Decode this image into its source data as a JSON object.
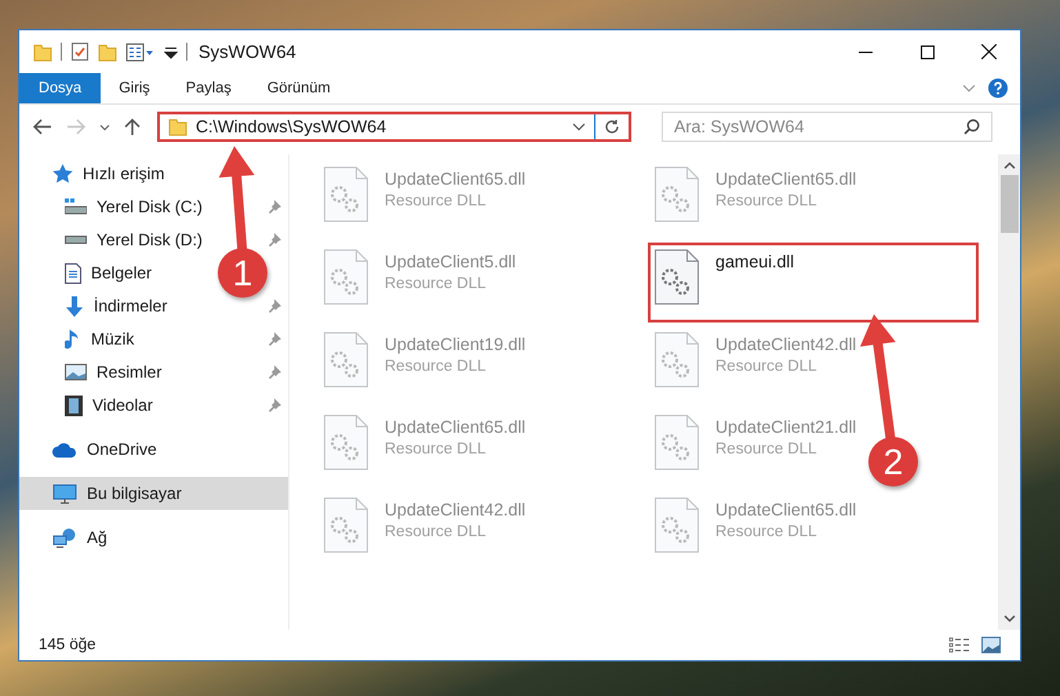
{
  "window": {
    "title": "SysWOW64"
  },
  "ribbon_tabs": [
    {
      "label": "Dosya",
      "selected": true
    },
    {
      "label": "Giriş",
      "selected": false
    },
    {
      "label": "Paylaş",
      "selected": false
    },
    {
      "label": "Görünüm",
      "selected": false
    }
  ],
  "navigation": {
    "back_disabled": false,
    "forward_disabled": true
  },
  "address_bar": {
    "value": "C:\\Windows\\SysWOW64",
    "highlighted": true
  },
  "search": {
    "placeholder": "Ara: SysWOW64"
  },
  "sidebar": {
    "items": [
      {
        "label": "Hızlı erişim",
        "selected": false,
        "children": [
          {
            "label": "Yerel Disk (C:)",
            "pinned": true,
            "selected": false
          },
          {
            "label": "Yerel Disk (D:)",
            "pinned": true,
            "selected": false
          },
          {
            "label": "Belgeler",
            "selected": false
          },
          {
            "label": "İndirmeler",
            "pinned": true,
            "selected": false
          },
          {
            "label": "Müzik",
            "pinned": true,
            "selected": false
          },
          {
            "label": "Resimler",
            "pinned": true,
            "selected": false
          },
          {
            "label": "Videolar",
            "pinned": true,
            "selected": false
          }
        ]
      },
      {
        "label": "OneDrive",
        "selected": false
      },
      {
        "label": "Bu bilgisayar",
        "selected": true
      },
      {
        "label": "Ağ",
        "selected": false
      }
    ]
  },
  "files": [
    {
      "name": "UpdateClient65.dll",
      "type": "Resource DLL",
      "dimmed": true,
      "highlighted": false
    },
    {
      "name": "UpdateClient65.dll",
      "type": "Resource DLL",
      "dimmed": true,
      "highlighted": false
    },
    {
      "name": "UpdateClient5.dll",
      "type": "Resource DLL",
      "dimmed": true,
      "highlighted": false
    },
    {
      "name": "gameui.dll",
      "dimmed": false,
      "highlighted": true
    },
    {
      "name": "UpdateClient19.dll",
      "type": "Resource DLL",
      "dimmed": true,
      "highlighted": false
    },
    {
      "name": "UpdateClient42.dll",
      "type": "Resource DLL",
      "dimmed": true,
      "highlighted": false
    },
    {
      "name": "UpdateClient65.dll",
      "type": "Resource DLL",
      "dimmed": true,
      "highlighted": false
    },
    {
      "name": "UpdateClient21.dll",
      "type": "Resource DLL",
      "dimmed": true,
      "highlighted": false
    },
    {
      "name": "UpdateClient42.dll",
      "type": "Resource DLL",
      "dimmed": true,
      "highlighted": false
    },
    {
      "name": "UpdateClient65.dll",
      "type": "Resource DLL",
      "dimmed": true,
      "highlighted": false
    }
  ],
  "status_bar": {
    "item_count": "145 öğe"
  },
  "annotations": [
    {
      "label": "1"
    },
    {
      "label": "2"
    }
  ]
}
